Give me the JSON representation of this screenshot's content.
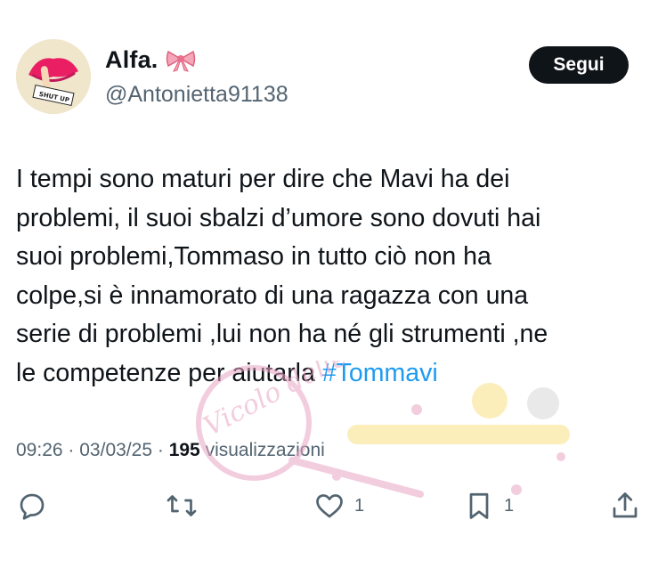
{
  "author": {
    "display_name": "Alfa.",
    "handle": "@Antonietta91138",
    "avatar_sticker_text": "SHUT UP"
  },
  "follow_button": {
    "label": "Segui"
  },
  "tweet": {
    "lines": [
      "I tempi sono maturi per dire che Mavi ha dei",
      "problemi, il suoi sbalzi d’umore sono dovuti hai",
      "suoi problemi,Tommaso in tutto ciò non ha",
      "colpe,si è innamorato di una ragazza con una",
      "serie di problemi ,lui non ha né gli strumenti ,ne",
      "le competenze per aiutarla "
    ],
    "hashtag": "#Tommavi"
  },
  "meta": {
    "time": "09:26",
    "date": "03/03/25",
    "views_count": "195",
    "views_label": "visualizzazioni"
  },
  "actions": {
    "likes_count": "1",
    "bookmarks_count": "1"
  },
  "watermark": {
    "text": "Vicolo delle News",
    "colors": {
      "pink": "#e8a5c4",
      "yellow": "#f3d34a"
    }
  },
  "colors": {
    "text": "#0f1419",
    "secondary": "#536471",
    "link": "#1d9bf0",
    "button_bg": "#0f1419"
  }
}
